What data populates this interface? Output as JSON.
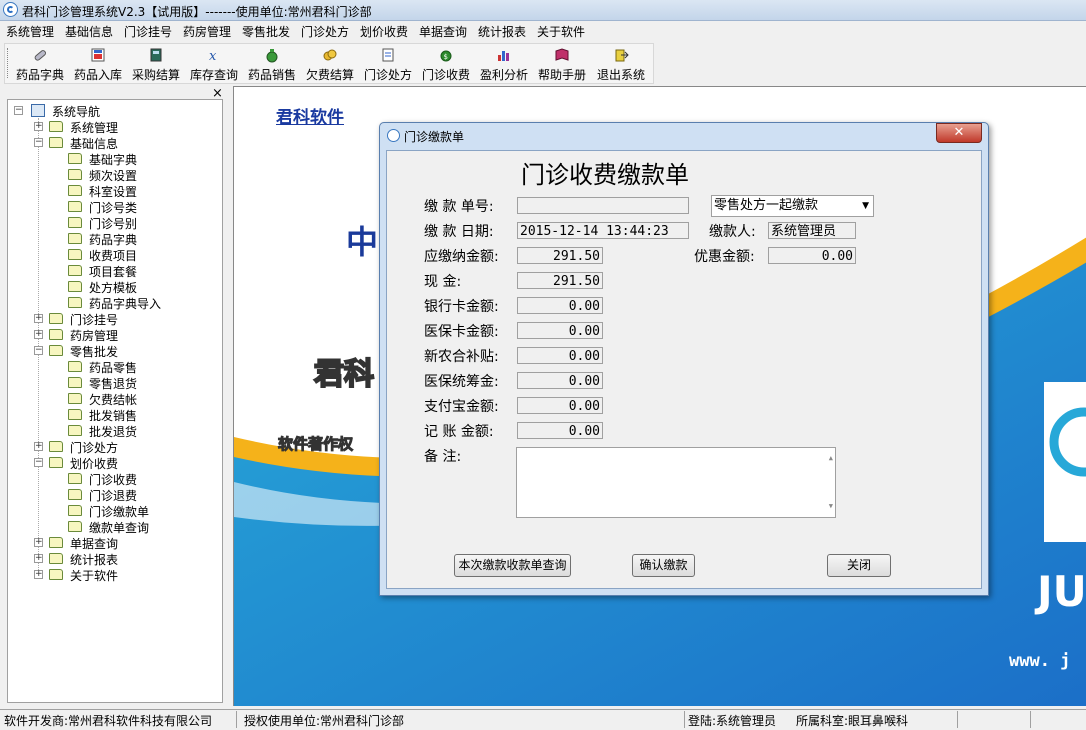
{
  "window": {
    "title": "君科门诊管理系统V2.3【试用版】-------使用单位:常州君科门诊部"
  },
  "menu": [
    "系统管理",
    "基础信息",
    "门诊挂号",
    "药房管理",
    "零售批发",
    "门诊处方",
    "划价收费",
    "单据查询",
    "统计报表",
    "关于软件"
  ],
  "toolbar": [
    {
      "label": "药品字典",
      "icon": "pill-icon"
    },
    {
      "label": "药品入库",
      "icon": "stock-in-icon"
    },
    {
      "label": "采购结算",
      "icon": "calculator-icon"
    },
    {
      "label": "库存查询",
      "icon": "formula-icon"
    },
    {
      "label": "药品销售",
      "icon": "money-bag-icon"
    },
    {
      "label": "欠费结算",
      "icon": "coins-icon"
    },
    {
      "label": "门诊处方",
      "icon": "prescription-icon"
    },
    {
      "label": "门诊收费",
      "icon": "cash-icon"
    },
    {
      "label": "盈利分析",
      "icon": "bar-chart-icon"
    },
    {
      "label": "帮助手册",
      "icon": "help-book-icon"
    },
    {
      "label": "退出系统",
      "icon": "exit-icon"
    }
  ],
  "nav": {
    "close": "×",
    "root": "系统导航",
    "items": [
      {
        "label": "系统管理",
        "level": 1,
        "exp": "+"
      },
      {
        "label": "基础信息",
        "level": 1,
        "exp": "−"
      },
      {
        "label": "基础字典",
        "level": 2
      },
      {
        "label": "频次设置",
        "level": 2
      },
      {
        "label": "科室设置",
        "level": 2
      },
      {
        "label": "门诊号类",
        "level": 2
      },
      {
        "label": "门诊号别",
        "level": 2
      },
      {
        "label": "药品字典",
        "level": 2
      },
      {
        "label": "收费项目",
        "level": 2
      },
      {
        "label": "项目套餐",
        "level": 2
      },
      {
        "label": "处方模板",
        "level": 2
      },
      {
        "label": "药品字典导入",
        "level": 2
      },
      {
        "label": "门诊挂号",
        "level": 1,
        "exp": "+"
      },
      {
        "label": "药房管理",
        "level": 1,
        "exp": "+"
      },
      {
        "label": "零售批发",
        "level": 1,
        "exp": "−"
      },
      {
        "label": "药品零售",
        "level": 2
      },
      {
        "label": "零售退货",
        "level": 2
      },
      {
        "label": "欠费结帐",
        "level": 2
      },
      {
        "label": "批发销售",
        "level": 2
      },
      {
        "label": "批发退货",
        "level": 2
      },
      {
        "label": "门诊处方",
        "level": 1,
        "exp": "+"
      },
      {
        "label": "划价收费",
        "level": 1,
        "exp": "−"
      },
      {
        "label": "门诊收费",
        "level": 2
      },
      {
        "label": "门诊退费",
        "level": 2
      },
      {
        "label": "门诊缴款单",
        "level": 2,
        "open": true
      },
      {
        "label": "缴款单查询",
        "level": 2
      },
      {
        "label": "单据查询",
        "level": 1,
        "exp": "+"
      },
      {
        "label": "统计报表",
        "level": 1,
        "exp": "+"
      },
      {
        "label": "关于软件",
        "level": 1,
        "exp": "+"
      }
    ]
  },
  "main": {
    "brand": "君科软件",
    "banner_zh": "中",
    "banner_logo": "君科",
    "banner_rights": "软件著作权",
    "banner_ju": "JU",
    "banner_www": "www. j"
  },
  "dialog": {
    "title": "门诊缴款单",
    "close": "✕",
    "heading": "门诊收费缴款单",
    "labels": {
      "no": "缴 款 单号:",
      "date": "缴 款 日期:",
      "payer": "缴款人:",
      "due": "应缴纳金额:",
      "discount": "优惠金额:",
      "cash": "现      金:",
      "bank": "银行卡金额:",
      "insurance": "医保卡金额:",
      "rural": "新农合补贴:",
      "pool": "医保统筹金:",
      "alipay": "支付宝金额:",
      "credit": "记 账 金额:",
      "remark": "备      注:"
    },
    "values": {
      "no": "",
      "combo": "零售处方一起缴款",
      "date": "2015-12-14 13:44:23",
      "payer": "系统管理员",
      "due": "291.50",
      "discount": "0.00",
      "cash": "291.50",
      "bank": "0.00",
      "insurance": "0.00",
      "rural": "0.00",
      "pool": "0.00",
      "alipay": "0.00",
      "credit": "0.00",
      "remark": ""
    },
    "buttons": {
      "query": "本次缴款收款单查询",
      "confirm": "确认缴款",
      "close": "关闭"
    }
  },
  "status": {
    "developer": "软件开发商:常州君科软件科技有限公司",
    "licensee": "授权使用单位:常州君科门诊部",
    "login": "登陆:系统管理员",
    "dept": "所属科室:眼耳鼻喉科"
  },
  "colors": {
    "banner_blue": "#1b6fc8",
    "banner_cyan": "#27a8d8",
    "banner_gold": "#f5b21a",
    "brand_text": "#1a3aa0"
  }
}
